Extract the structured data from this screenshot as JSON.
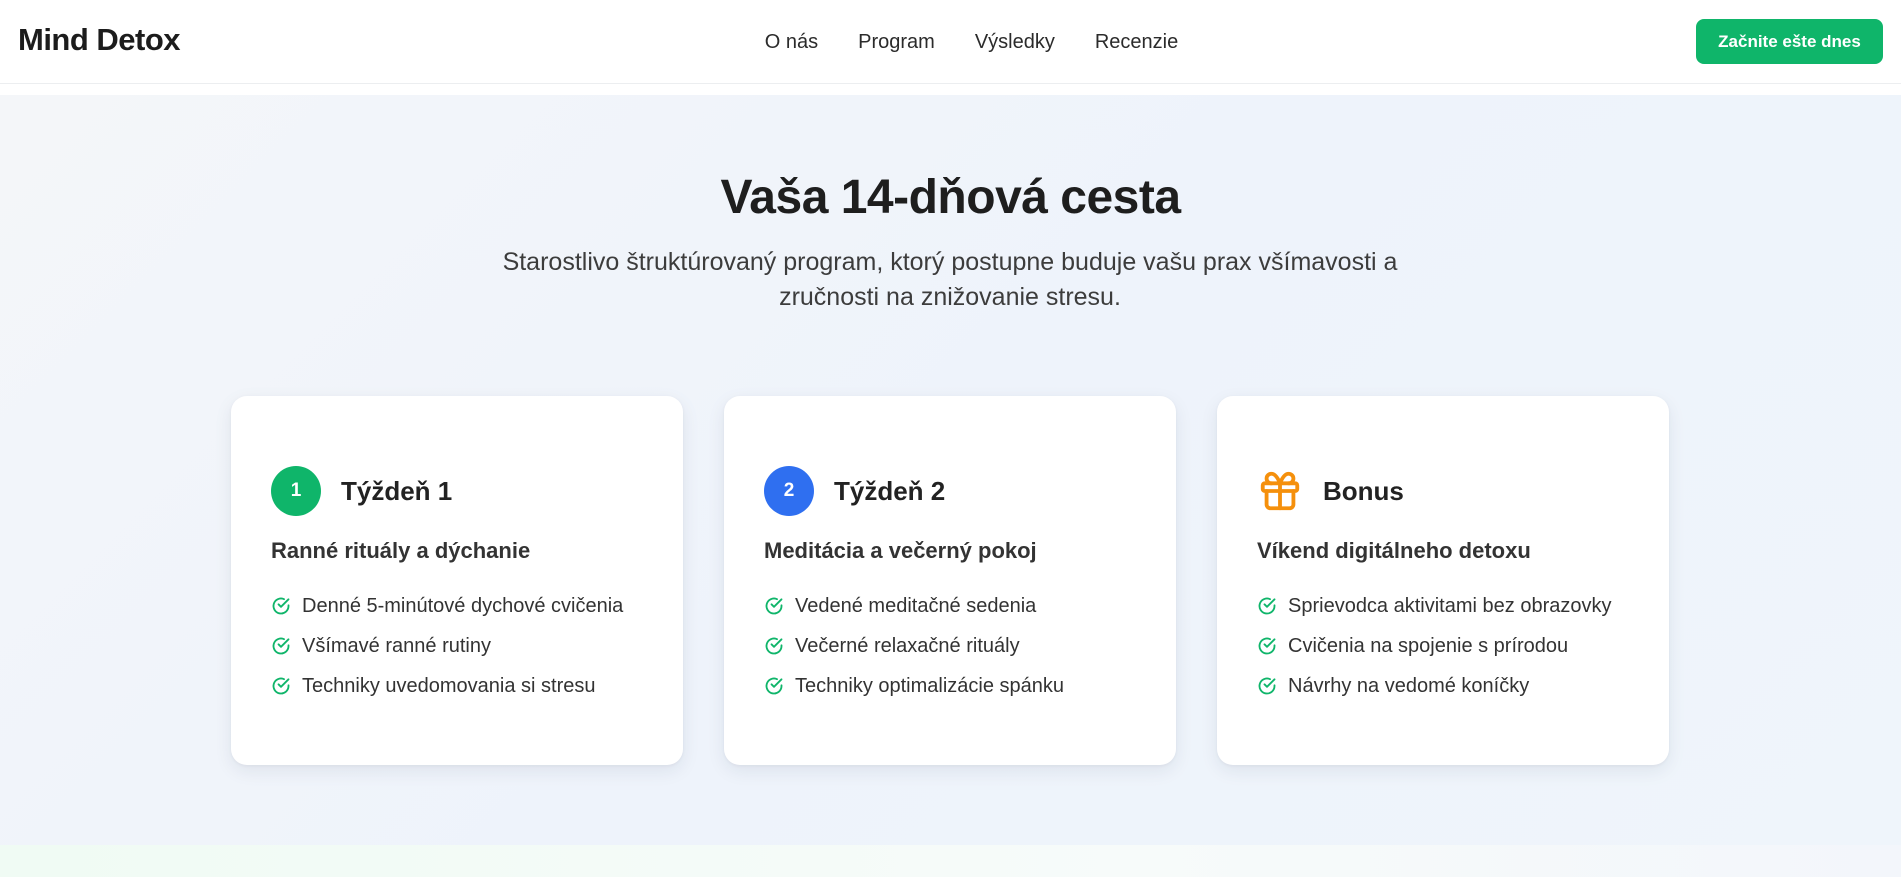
{
  "header": {
    "logo": "Mind Detox",
    "nav": [
      "O nás",
      "Program",
      "Výsledky",
      "Recenzie"
    ],
    "cta_label": "Začnite ešte dnes"
  },
  "colors": {
    "accent_green": "#0fb56a",
    "accent_blue": "#2f6ff0",
    "accent_orange": "#f5900c"
  },
  "section": {
    "title": "Vaša 14-dňová cesta",
    "subtitle": "Starostlivo štruktúrovaný program, ktorý postupne buduje vašu prax všímavosti a zručnosti na znižovanie stresu."
  },
  "cards": [
    {
      "badge": "1",
      "icon": "number-badge",
      "title": "Týždeň 1",
      "subtitle": "Ranné rituály a dýchanie",
      "items": [
        "Denné 5-minútové dychové cvičenia",
        "Všímavé ranné rutiny",
        "Techniky uvedomovania si stresu"
      ]
    },
    {
      "badge": "2",
      "icon": "number-badge",
      "title": "Týždeň 2",
      "subtitle": "Meditácia a večerný pokoj",
      "items": [
        "Vedené meditačné sedenia",
        "Večerné relaxačné rituály",
        "Techniky optimalizácie spánku"
      ]
    },
    {
      "icon": "gift-icon",
      "title": "Bonus",
      "subtitle": "Víkend digitálneho detoxu",
      "items": [
        "Sprievodca aktivitami bez obrazovky",
        "Cvičenia na spojenie s prírodou",
        "Návrhy na vedomé koníčky"
      ]
    }
  ]
}
